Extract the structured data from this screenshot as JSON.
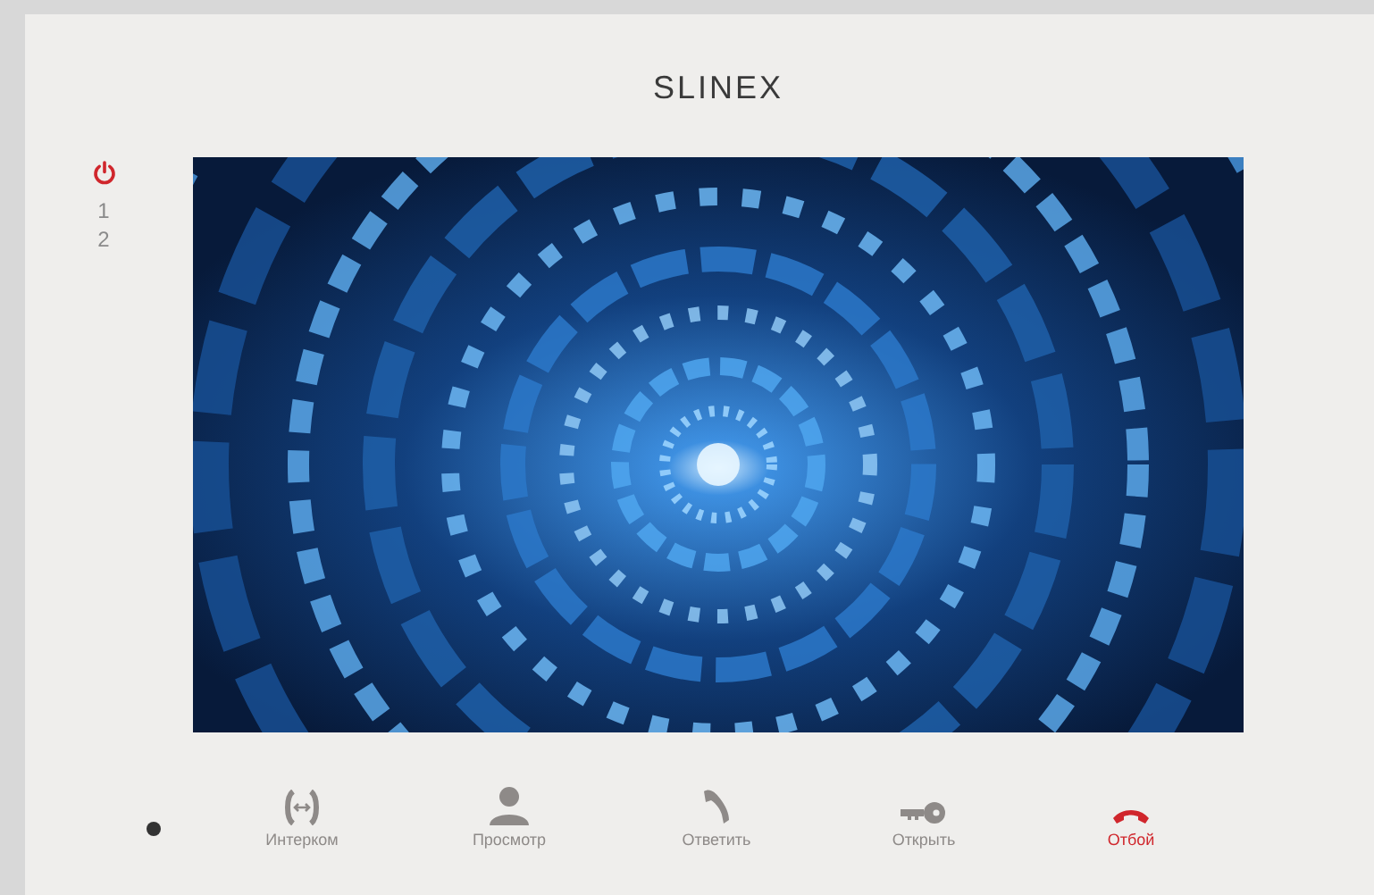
{
  "logo": "SLINEX",
  "channels": [
    "1",
    "2"
  ],
  "buttons": [
    {
      "kind": "intercom",
      "label": "Интерком"
    },
    {
      "kind": "view",
      "label": "Просмотр"
    },
    {
      "kind": "answer",
      "label": "Ответить"
    },
    {
      "kind": "open",
      "label": "Открыть"
    },
    {
      "kind": "hangup",
      "label": "Отбой"
    }
  ]
}
